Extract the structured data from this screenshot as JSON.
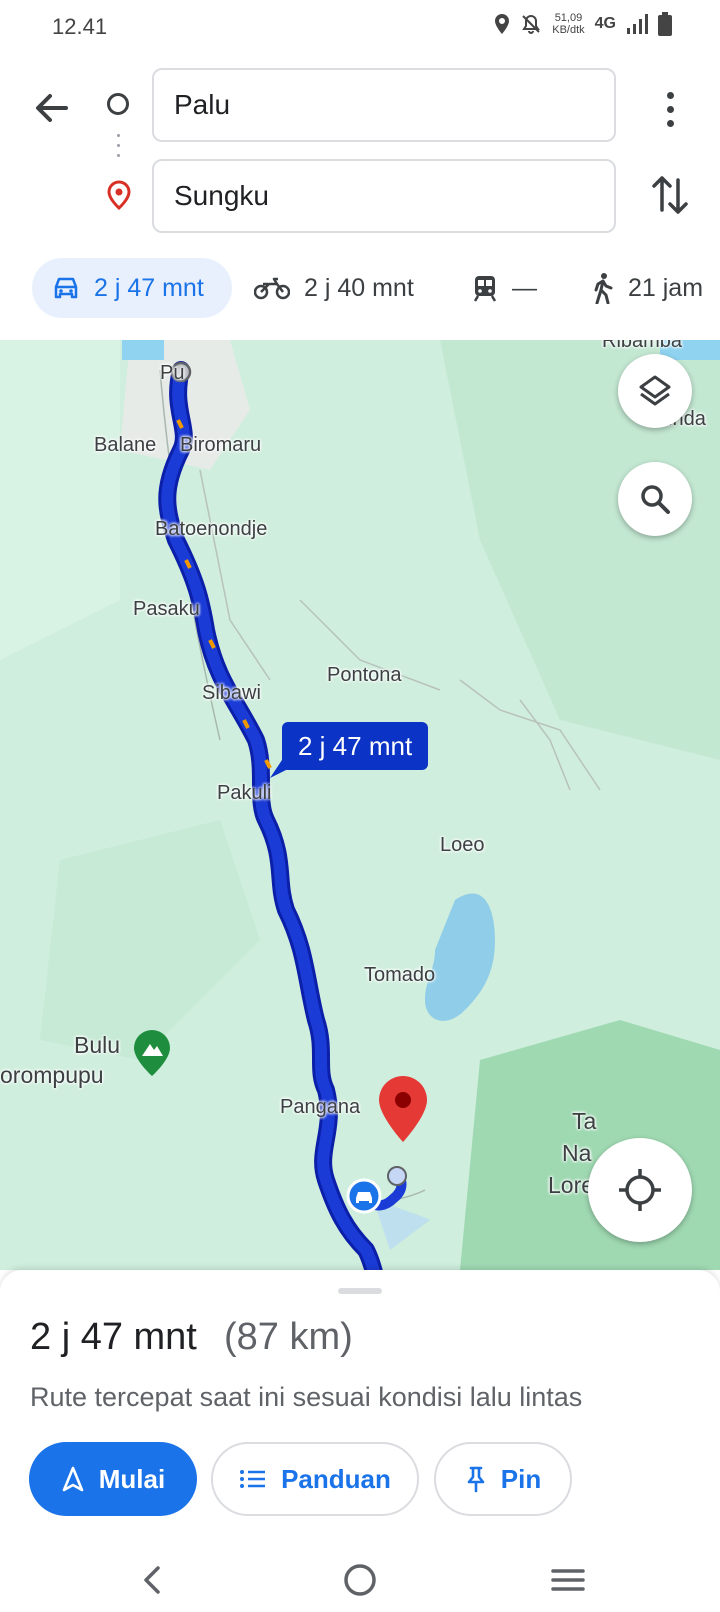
{
  "status": {
    "time": "12.41",
    "speed_value": "51,09",
    "speed_unit": "KB/dtk",
    "network": "4G"
  },
  "route": {
    "origin": "Palu",
    "destination": "Sungku"
  },
  "modes": [
    {
      "name": "car",
      "label": "2 j 47 mnt",
      "active": true
    },
    {
      "name": "motorcycle",
      "label": "2 j 40 mnt"
    },
    {
      "name": "transit",
      "label": "—"
    },
    {
      "name": "walk",
      "label": "21 jam"
    }
  ],
  "map": {
    "places": [
      "Ribamba",
      "Pu",
      "Balane",
      "Biromaru",
      "Batoenondje",
      "Pasaku",
      "Pontona",
      "Sibawi",
      "Pakuli",
      "Loeo",
      "Tomado",
      "Bulu",
      "orompupu",
      "Pangana",
      "Ta",
      "Na",
      "Lore",
      "inda"
    ],
    "duration_callout": "2 j 47 mnt"
  },
  "summary": {
    "time": "2 j 47 mnt",
    "distance": "(87 km)",
    "description": "Rute tercepat saat ini sesuai kondisi lalu lintas"
  },
  "actions": {
    "start": "Mulai",
    "guide": "Panduan",
    "pin": "Pin"
  },
  "icons": [
    "back-icon",
    "origin-circle-icon",
    "destination-pin-icon",
    "more-vert-icon",
    "swap-icon",
    "car-icon",
    "motorcycle-icon",
    "train-icon",
    "walk-icon",
    "layers-icon",
    "search-icon",
    "my-location-icon",
    "navigation-icon",
    "list-icon",
    "pin-icon"
  ],
  "colors": {
    "accent": "#1a73e8",
    "route": "#1a3bd6",
    "destination": "#e53935",
    "map_land": "#cfeedd"
  }
}
